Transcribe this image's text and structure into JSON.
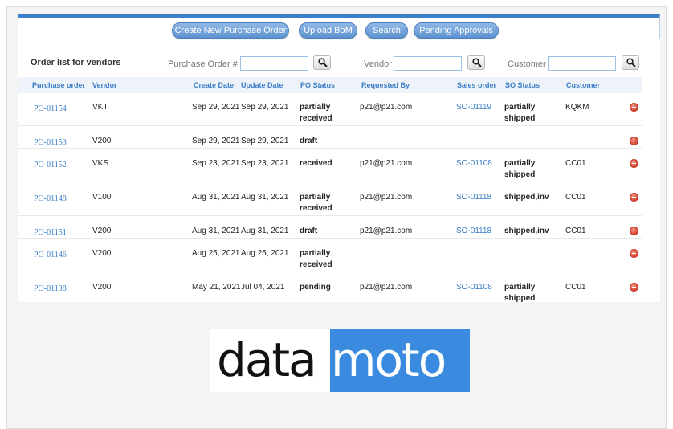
{
  "toolbar": {
    "create_po": "Create New Purchase Order",
    "upload_bom": "Upload BoM",
    "search": "Search",
    "pending_approvals": "Pending Approvals"
  },
  "section_title": "Order list for vendors",
  "filters": {
    "po_label": "Purchase Order #",
    "po_value": "",
    "vendor_label": "Vendor",
    "vendor_value": "",
    "customer_label": "Customer",
    "customer_value": ""
  },
  "columns": {
    "purchase_order": "Purchase order",
    "vendor": "Vendor",
    "create_date": "Create Date",
    "update_date": "Update Date",
    "po_status": "PO Status",
    "requested_by": "Requested By",
    "sales_order": "Sales order",
    "so_status": "SO Status",
    "customer": "Customer"
  },
  "rows": [
    {
      "po": "PO-01154",
      "vendor": "VKT",
      "create": "Sep 29, 2021",
      "update": "Sep 29, 2021",
      "po_status": "partially received",
      "requested_by": "p21@p21.com",
      "so": "SO-01119",
      "so_status": "partially shipped",
      "customer": "KQKM"
    },
    {
      "po": "PO-01153",
      "vendor": "V200",
      "create": "Sep 29, 2021",
      "update": "Sep 29, 2021",
      "po_status": "draft",
      "requested_by": "",
      "so": "",
      "so_status": "",
      "customer": ""
    },
    {
      "po": "PO-01152",
      "vendor": "VKS",
      "create": "Sep 23, 2021",
      "update": "Sep 23, 2021",
      "po_status": "received",
      "requested_by": "p21@p21.com",
      "so": "SO-01108",
      "so_status": "partially shipped",
      "customer": "CC01"
    },
    {
      "po": "PO-01148",
      "vendor": "V100",
      "create": "Aug 31, 2021",
      "update": "Aug 31, 2021",
      "po_status": "partially received",
      "requested_by": "p21@p21.com",
      "so": "SO-01118",
      "so_status": "shipped,inv",
      "customer": "CC01"
    },
    {
      "po": "PO-01151",
      "vendor": "V200",
      "create": "Aug 31, 2021",
      "update": "Aug 31, 2021",
      "po_status": "draft",
      "requested_by": "p21@p21.com",
      "so": "SO-01118",
      "so_status": "shipped,inv",
      "customer": "CC01"
    },
    {
      "po": "PO-01146",
      "vendor": "V200",
      "create": "Aug 25, 2021",
      "update": "Aug 25, 2021",
      "po_status": "partially received",
      "requested_by": "",
      "so": "",
      "so_status": "",
      "customer": ""
    },
    {
      "po": "PO-01138",
      "vendor": "V200",
      "create": "May 21, 2021",
      "update": "Jul 04, 2021",
      "po_status": "pending",
      "requested_by": "p21@p21.com",
      "so": "SO-01108",
      "so_status": "partially shipped",
      "customer": "CC01"
    }
  ],
  "logo": {
    "part1": "data",
    "part2": "moto"
  },
  "colors": {
    "accent": "#3b7fcb",
    "link": "#3a7cc7",
    "delete": "#d9452f",
    "logo_blue": "#3a8be0"
  }
}
